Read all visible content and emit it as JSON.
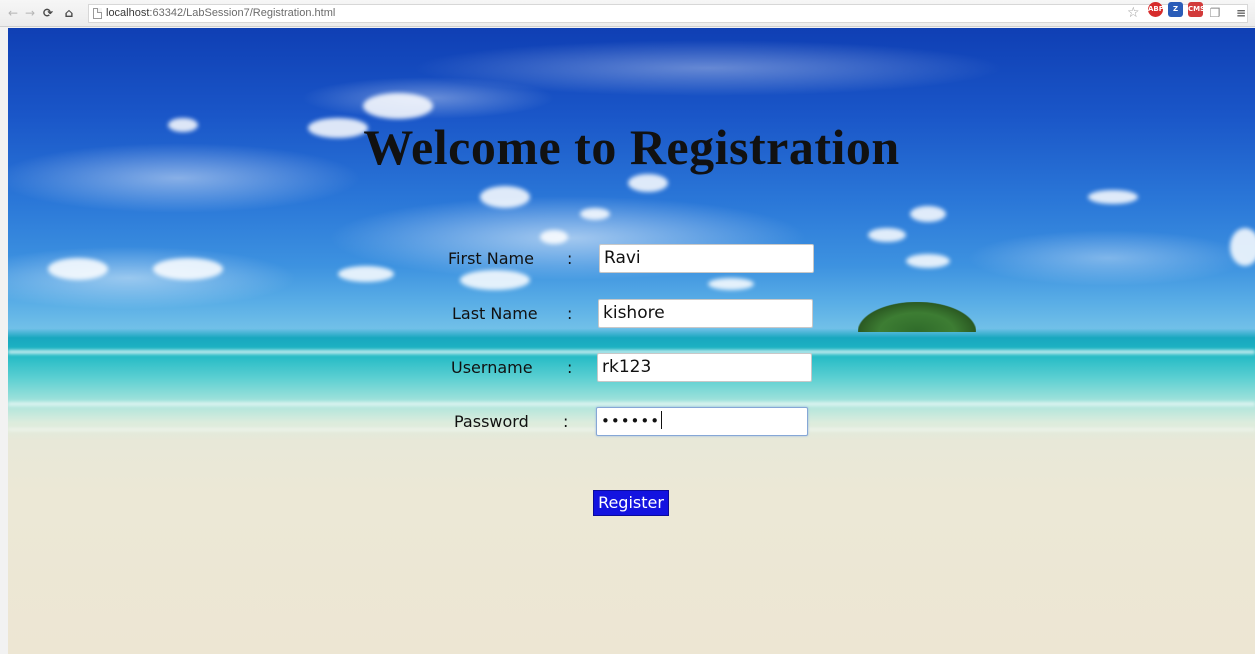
{
  "browser": {
    "url_host": "localhost",
    "url_path": ":63342/LabSession7/Registration.html",
    "extensions": [
      "ABP",
      "Z",
      "CMS"
    ]
  },
  "page": {
    "title": "Welcome to Registration"
  },
  "form": {
    "first_name": {
      "label": "First Name",
      "separator": ":",
      "value": "Ravi"
    },
    "last_name": {
      "label": "Last Name",
      "separator": ":",
      "value": "kishore"
    },
    "username": {
      "label": "Username",
      "separator": ":",
      "value": "rk123"
    },
    "password": {
      "label": "Password",
      "separator": ":",
      "masked_value": "••••••"
    },
    "submit_label": "Register"
  },
  "colors": {
    "register_button": "#1313e0",
    "title_text": "#111111"
  }
}
